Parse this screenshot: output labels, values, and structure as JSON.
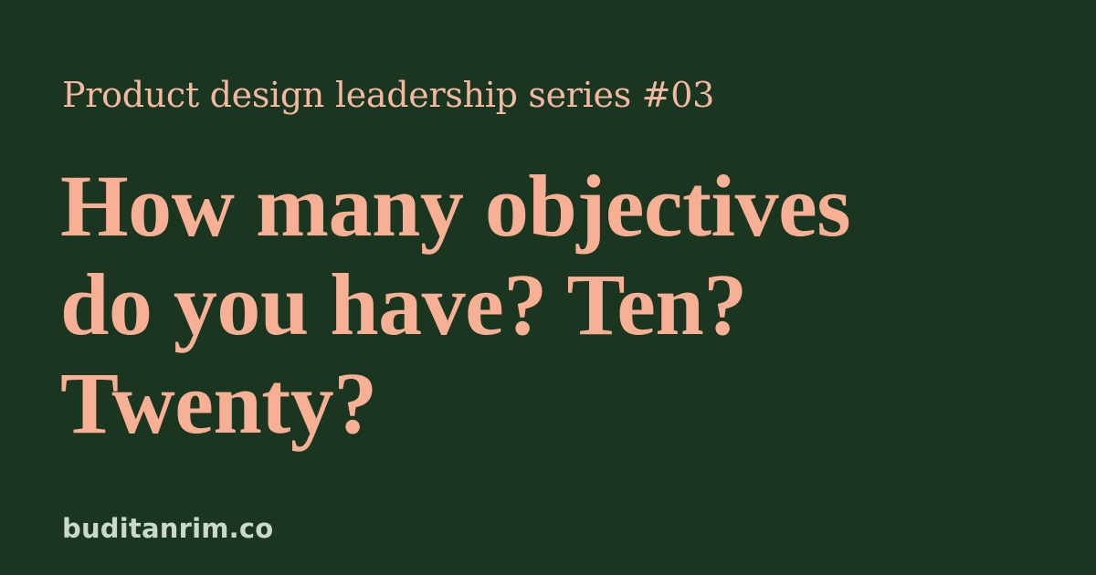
{
  "colors": {
    "background": "#1a3520",
    "accent": "#f7b094",
    "subtitle": "#f2b9a0",
    "domain": "#cbd9cb"
  },
  "card": {
    "series_label": "Product design leadership series #03",
    "headline_lines": [
      "How many objectives",
      "do you have? Ten?",
      "Twenty?"
    ],
    "domain": "buditanrim.co"
  }
}
